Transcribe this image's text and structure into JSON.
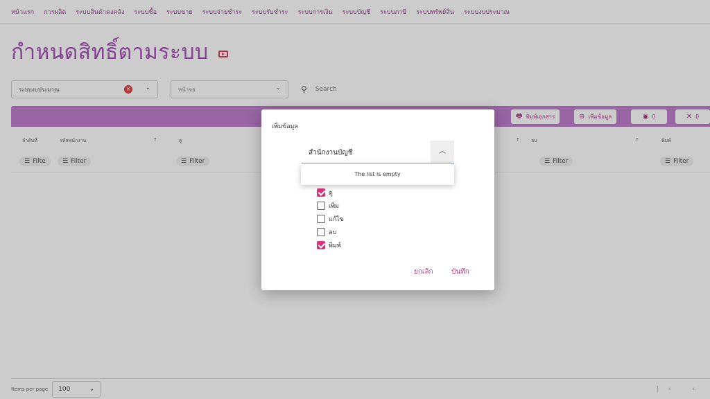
{
  "nav": [
    "หน้าแรก",
    "การผลิต",
    "ระบบสินค้าคงคลัง",
    "ระบบซื้อ",
    "ระบบขาย",
    "ระบบจ่ายชำระ",
    "ระบบรับชำระ",
    "ระบบการเงิน",
    "ระบบบัญชี",
    "ระบบภาษี",
    "ระบบทรัพย์สิน",
    "ระบบงบประมาณ"
  ],
  "page_title": "กำหนดสิทธิ์ตามระบบ",
  "filters": {
    "system_value": "ระบบงบประมาณ",
    "screen_placeholder": "หน้าจอ",
    "search_placeholder": "Search"
  },
  "toolbar": {
    "print_label": "พิมพ์เอกสาร",
    "add_label": "เพิ่มข้อมูล",
    "visible_count": "0",
    "hidden_count": "0"
  },
  "table": {
    "headers": [
      "ลำดับที่",
      "รหัสพนักงาน",
      "ดู",
      "ลบ",
      "พิมพ์"
    ],
    "filter_label": "Filter",
    "filter_label_short": "Filte"
  },
  "footer": {
    "items_per_page_label": "Items per page",
    "items_per_page_value": "100"
  },
  "dialog": {
    "title": "เพิ่มข้อมูล",
    "combo_value": "สำนักงานบัญชี",
    "empty_text": "The list is empty",
    "checkboxes": [
      {
        "label": "ดู",
        "checked": true
      },
      {
        "label": "เพิ่ม",
        "checked": false
      },
      {
        "label": "แก้ไข",
        "checked": false
      },
      {
        "label": "ลบ",
        "checked": false
      },
      {
        "label": "พิมพ์",
        "checked": true
      }
    ],
    "cancel_label": "ยกเลิก",
    "save_label": "บันทึก"
  },
  "colors": {
    "accent": "#a44fb4",
    "toolbar": "#c07fcf",
    "action": "#d6337a"
  }
}
